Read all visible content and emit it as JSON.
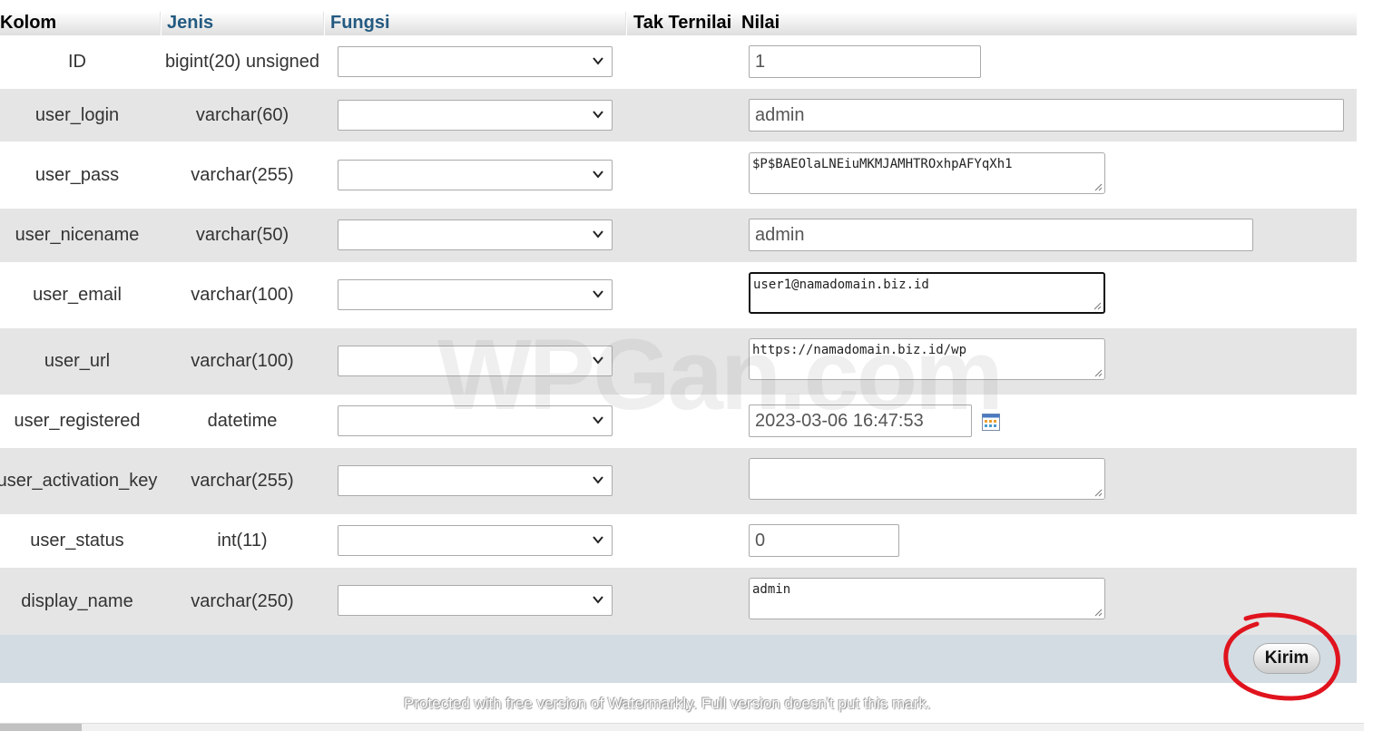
{
  "header": {
    "kolom": "Kolom",
    "jenis": "Jenis",
    "fungsi": "Fungsi",
    "tak_ternilai": "Tak Ternilai",
    "nilai": "Nilai"
  },
  "rows": [
    {
      "column": "ID",
      "type": "bigint(20) unsigned",
      "function": "",
      "value": "1"
    },
    {
      "column": "user_login",
      "type": "varchar(60)",
      "function": "",
      "value": "admin"
    },
    {
      "column": "user_pass",
      "type": "varchar(255)",
      "function": "",
      "value": "$P$BAEOlaLNEiuMKMJAMHTROxhpAFYqXh1"
    },
    {
      "column": "user_nicename",
      "type": "varchar(50)",
      "function": "",
      "value": "admin"
    },
    {
      "column": "user_email",
      "type": "varchar(100)",
      "function": "",
      "value": "user1@namadomain.biz.id"
    },
    {
      "column": "user_url",
      "type": "varchar(100)",
      "function": "",
      "value": "https://namadomain.biz.id/wp"
    },
    {
      "column": "user_registered",
      "type": "datetime",
      "function": "",
      "value": "2023-03-06 16:47:53"
    },
    {
      "column": "user_activation_key",
      "type": "varchar(255)",
      "function": "",
      "value": ""
    },
    {
      "column": "user_status",
      "type": "int(11)",
      "function": "",
      "value": "0"
    },
    {
      "column": "display_name",
      "type": "varchar(250)",
      "function": "",
      "value": "admin"
    }
  ],
  "submit_label": "Kirim",
  "watermark": "WPGan.com",
  "watermark_notice": "Protected with free version of Watermarkly. Full version doesn't put this mark.",
  "icons": {
    "select": "chevron-down-icon",
    "calendar": "calendar-icon",
    "resize": "resize-grip-icon"
  },
  "colors": {
    "header_link": "#235a81",
    "row_alt": "#e5e5e5",
    "footer": "#d3dce3",
    "annotation": "#e0141e"
  }
}
